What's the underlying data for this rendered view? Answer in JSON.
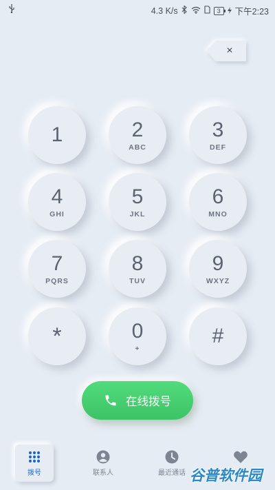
{
  "status_bar": {
    "speed": "4.3 K/s",
    "battery": "3",
    "time": "下午2:23"
  },
  "delete_label": "×",
  "keys": [
    {
      "digit": "1",
      "letters": ""
    },
    {
      "digit": "2",
      "letters": "ABC"
    },
    {
      "digit": "3",
      "letters": "DEF"
    },
    {
      "digit": "4",
      "letters": "GHI"
    },
    {
      "digit": "5",
      "letters": "JKL"
    },
    {
      "digit": "6",
      "letters": "MNO"
    },
    {
      "digit": "7",
      "letters": "PQRS"
    },
    {
      "digit": "8",
      "letters": "TUV"
    },
    {
      "digit": "9",
      "letters": "WXYZ"
    },
    {
      "digit": "*",
      "letters": ""
    },
    {
      "digit": "0",
      "letters": "+"
    },
    {
      "digit": "#",
      "letters": ""
    }
  ],
  "call_button": {
    "label": "在线拨号",
    "color": "#44c96f"
  },
  "nav": [
    {
      "label": "拨号",
      "icon": "dialpad-icon",
      "active": true
    },
    {
      "label": "联系人",
      "icon": "contact-icon",
      "active": false
    },
    {
      "label": "最近通话",
      "icon": "clock-icon",
      "active": false
    },
    {
      "label": "",
      "icon": "heart-icon",
      "active": false
    }
  ],
  "watermark": "谷普软件园",
  "colors": {
    "accent": "#1f67c4",
    "background": "#e6ecf4"
  }
}
